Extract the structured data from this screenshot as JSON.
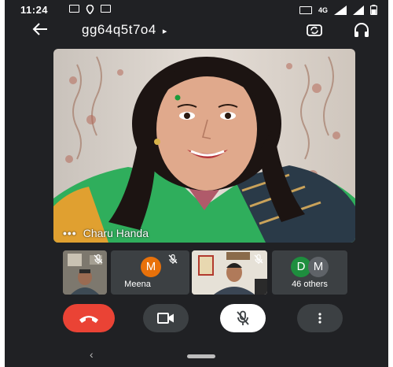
{
  "status_bar": {
    "time": "11:24",
    "network": "4G"
  },
  "top_bar": {
    "meeting_code": "gg64q5t7o4",
    "caret": "▸"
  },
  "main_video": {
    "participant_name": "Charu Handa",
    "more_dots": "•••"
  },
  "participant_strip": [
    {
      "kind": "video",
      "muted": true
    },
    {
      "kind": "avatar",
      "initial": "M",
      "name": "Meena",
      "avatar_color": "#e8710a",
      "muted": true
    },
    {
      "kind": "video",
      "muted": true
    },
    {
      "kind": "group",
      "initials": [
        "D",
        "M"
      ],
      "label": "46 others",
      "avatar_colors": [
        "#1e8e3e",
        "#5f6368"
      ]
    }
  ],
  "controls": {
    "end_call_color": "#ea4335",
    "camera_icon": "video-camera-icon",
    "mic_icon": "mic-off-icon",
    "more_icon": "more-vert-icon"
  },
  "nav": {
    "back_glyph": "‹"
  }
}
